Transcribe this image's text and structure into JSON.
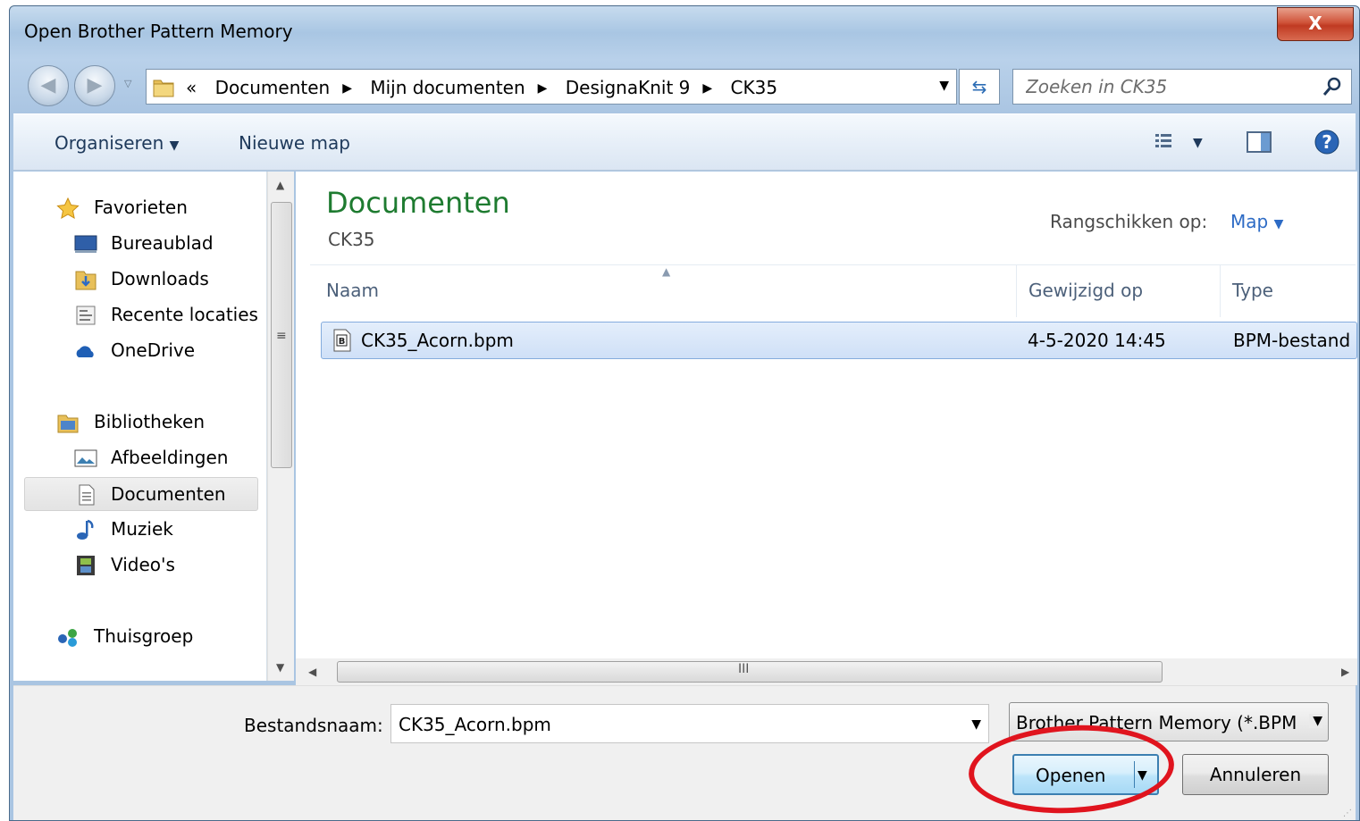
{
  "window": {
    "title": "Open Brother Pattern Memory",
    "close_label": "X"
  },
  "address": {
    "crumbs": [
      "Documenten",
      "Mijn documenten",
      "DesignaKnit 9",
      "CK35"
    ],
    "overflow": "«"
  },
  "search": {
    "placeholder": "Zoeken in CK35"
  },
  "toolbar": {
    "organize_label": "Organiseren",
    "new_folder_label": "Nieuwe map"
  },
  "nav": {
    "favorites": {
      "label": "Favorieten",
      "items": [
        "Bureaublad",
        "Downloads",
        "Recente locaties",
        "OneDrive"
      ]
    },
    "libraries": {
      "label": "Bibliotheken",
      "items": [
        "Afbeeldingen",
        "Documenten",
        "Muziek",
        "Video's"
      ]
    },
    "homegroup": {
      "label": "Thuisgroep"
    },
    "selected": "Documenten"
  },
  "content": {
    "library_title": "Documenten",
    "library_sub": "CK35",
    "arrange_label": "Rangschikken op:",
    "arrange_value": "Map",
    "columns": {
      "name": "Naam",
      "modified": "Gewijzigd op",
      "type": "Type"
    },
    "files": [
      {
        "name": "CK35_Acorn.bpm",
        "modified": "4-5-2020 14:45",
        "type": "BPM-bestand"
      }
    ]
  },
  "footer": {
    "filename_label": "Bestandsnaam:",
    "filename_value": "CK35_Acorn.bpm",
    "filter_value": "Brother Pattern Memory (*.BPM",
    "open_label": "Openen",
    "cancel_label": "Annuleren"
  },
  "colors": {
    "accent_green": "#1e7b30",
    "link_blue": "#2d6bc5",
    "highlight_red": "#e0141e"
  }
}
